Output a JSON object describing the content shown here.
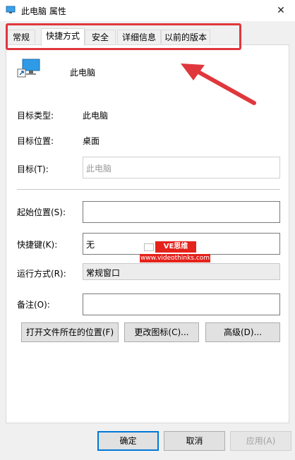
{
  "window": {
    "title": "此电脑 属性",
    "close_glyph": "✕"
  },
  "tabs": [
    {
      "label": "常规",
      "active": false
    },
    {
      "label": "快捷方式",
      "active": true
    },
    {
      "label": "安全",
      "active": false
    },
    {
      "label": "详细信息",
      "active": false
    },
    {
      "label": "以前的版本",
      "active": false
    }
  ],
  "shortcut": {
    "name": "此电脑",
    "target_type_label": "目标类型:",
    "target_type_value": "此电脑",
    "target_location_label": "目标位置:",
    "target_location_value": "桌面",
    "target_label": "目标(T):",
    "target_value": "此电脑",
    "start_in_label": "起始位置(S):",
    "start_in_value": "",
    "hotkey_label": "快捷键(K):",
    "hotkey_value": "无",
    "run_label": "运行方式(R):",
    "run_value": "常规窗口",
    "comment_label": "备注(O):",
    "comment_value": ""
  },
  "buttons": {
    "open_location": "打开文件所在的位置(F)",
    "change_icon": "更改图标(C)...",
    "advanced": "高级(D)...",
    "ok": "确定",
    "cancel": "取消",
    "apply": "应用(A)"
  },
  "watermark": {
    "badge": "VE思维",
    "url": "www.videothinks.com"
  },
  "colors": {
    "highlight": "#e0373c",
    "accent": "#0078d7",
    "watermark": "#e5221b"
  },
  "icons": {
    "title": "computer-icon",
    "shortcut": "computer-shortcut-icon",
    "dropdown": "chevron-down-icon"
  }
}
